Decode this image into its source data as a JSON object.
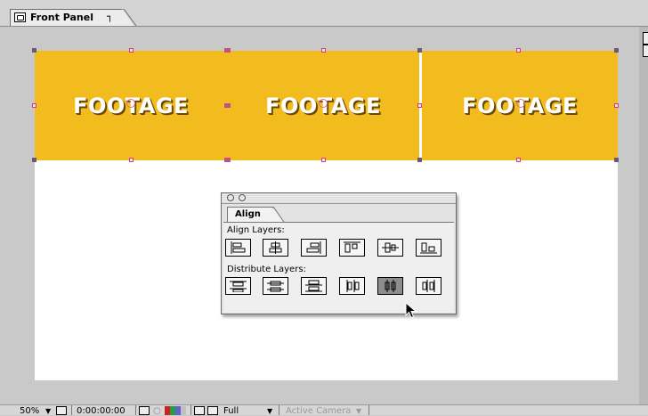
{
  "window": {
    "tab_title": "Front Panel",
    "tab_close": "┐"
  },
  "composition": {
    "layers": [
      {
        "label": "FOOTAGE"
      },
      {
        "label": "FOOTAGE"
      },
      {
        "label": "FOOTAGE"
      }
    ],
    "layer_color": "#f2bc1e"
  },
  "align_palette": {
    "tab_label": "Align",
    "align_section_label": "Align Layers:",
    "distribute_section_label": "Distribute  Layers:",
    "align_buttons": [
      {
        "icon": "align-left-icon"
      },
      {
        "icon": "align-horizontal-center-icon"
      },
      {
        "icon": "align-right-icon"
      },
      {
        "icon": "align-top-icon"
      },
      {
        "icon": "align-vertical-center-icon"
      },
      {
        "icon": "align-bottom-icon"
      }
    ],
    "distribute_buttons": [
      {
        "icon": "distribute-top-icon"
      },
      {
        "icon": "distribute-vertical-center-icon"
      },
      {
        "icon": "distribute-bottom-icon"
      },
      {
        "icon": "distribute-left-icon"
      },
      {
        "icon": "distribute-horizontal-center-icon",
        "pressed": true
      },
      {
        "icon": "distribute-right-icon"
      }
    ]
  },
  "status_bar": {
    "zoom": "50%",
    "zoom_arrow": "▼",
    "timecode": "0:00:00:00",
    "resolution": "Full",
    "resolution_arrow": "▼",
    "camera": "Active Camera",
    "camera_arrow": "▼"
  }
}
